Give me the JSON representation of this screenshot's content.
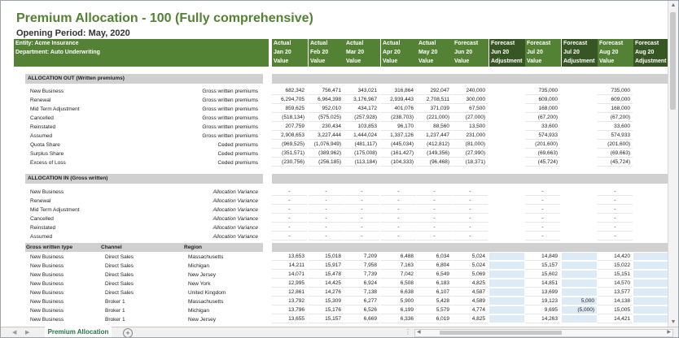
{
  "title": "Premium Allocation - 100 (Fully comprehensive)",
  "subtitle": "Opening Period: May, 2020",
  "header": {
    "entity": "Entity: Acme Insurance",
    "department": "Department: Auto Underwriting",
    "columns": [
      {
        "l1": "Actual",
        "l2": "Jan 20",
        "l3": "Value"
      },
      {
        "l1": "Actual",
        "l2": "Feb 20",
        "l3": "Value"
      },
      {
        "l1": "Actual",
        "l2": "Mar 20",
        "l3": "Value"
      },
      {
        "l1": "Actual",
        "l2": "Apr 20",
        "l3": "Value"
      },
      {
        "l1": "Actual",
        "l2": "May 20",
        "l3": "Value"
      },
      {
        "l1": "Forecast",
        "l2": "Jun 20",
        "l3": "Value"
      },
      {
        "l1": "Forecast",
        "l2": "Jun 20",
        "l3": "Adjustment"
      },
      {
        "l1": "Forecast",
        "l2": "Jul 20",
        "l3": "Value"
      },
      {
        "l1": "Forecast",
        "l2": "Jul 20",
        "l3": "Adjustment"
      },
      {
        "l1": "Forecast",
        "l2": "Aug 20",
        "l3": "Value"
      },
      {
        "l1": "Forecast",
        "l2": "Aug 20",
        "l3": "Adjustment"
      }
    ]
  },
  "sections": {
    "out_title": "ALLOCATION OUT (Written premiums)",
    "in_title": "ALLOCATION IN (Gross written)"
  },
  "alloc_out": [
    {
      "label": "New Business",
      "type": "Gross written premiums",
      "v": [
        "682,342",
        "756,471",
        "343,021",
        "316,864",
        "292,047",
        "240,000",
        "",
        "735,000",
        "",
        "735,000",
        ""
      ]
    },
    {
      "label": "Renewal",
      "type": "Gross written premiums",
      "v": [
        "6,294,705",
        "6,964,398",
        "3,176,967",
        "2,939,443",
        "2,708,511",
        "300,000",
        "",
        "609,000",
        "",
        "609,000",
        ""
      ]
    },
    {
      "label": "Mid Term Adjustment",
      "type": "Gross written premiums",
      "v": [
        "859,625",
        "952,010",
        "434,172",
        "401,076",
        "371,039",
        "67,500",
        "",
        "168,000",
        "",
        "168,000",
        ""
      ]
    },
    {
      "label": "Cancelled",
      "type": "Gross written premiums",
      "v": [
        "(518,134)",
        "(575,025)",
        "(257,928)",
        "(238,703)",
        "(221,000)",
        "(27,000)",
        "",
        "(67,200)",
        "",
        "(67,200)",
        ""
      ]
    },
    {
      "label": "Reinstated",
      "type": "Gross written premiums",
      "v": [
        "207,759",
        "230,434",
        "103,853",
        "96,170",
        "88,560",
        "13,500",
        "",
        "33,600",
        "",
        "33,600",
        ""
      ]
    },
    {
      "label": "Assumed",
      "type": "Gross written premiums",
      "v": [
        "2,908,653",
        "3,227,444",
        "1,444,024",
        "1,337,126",
        "1,237,447",
        "231,000",
        "",
        "574,933",
        "",
        "574,933",
        ""
      ]
    },
    {
      "label": "Quota Share",
      "type": "Ceded premiums",
      "v": [
        "(969,525)",
        "(1,076,949)",
        "(481,117)",
        "(445,034)",
        "(412,812)",
        "(81,000)",
        "",
        "(201,600)",
        "",
        "(201,600)",
        ""
      ]
    },
    {
      "label": "Surplus Share",
      "type": "Ceded premiums",
      "v": [
        "(351,571)",
        "(389,962)",
        "(175,008)",
        "(161,427)",
        "(149,356)",
        "(27,990)",
        "",
        "(69,663)",
        "",
        "(69,663)",
        ""
      ]
    },
    {
      "label": "Excess of Loss",
      "type": "Ceded premiums",
      "v": [
        "(230,756)",
        "(256,185)",
        "(113,184)",
        "(104,333)",
        "(96,468)",
        "(18,371)",
        "",
        "(45,724)",
        "",
        "(45,724)",
        ""
      ]
    }
  ],
  "alloc_in": [
    {
      "label": "New Business",
      "type": "Allocation Variance",
      "v": [
        "-",
        "-",
        "-",
        "-",
        "-",
        "-",
        "",
        "-",
        "",
        "-",
        ""
      ]
    },
    {
      "label": "Renewal",
      "type": "Allocation Variance",
      "v": [
        "-",
        "-",
        "-",
        "-",
        "-",
        "-",
        "",
        "-",
        "",
        "-",
        ""
      ]
    },
    {
      "label": "Mid Term Adjustment",
      "type": "Allocation Variance",
      "v": [
        "-",
        "-",
        "-",
        "-",
        "-",
        "-",
        "",
        "-",
        "",
        "-",
        ""
      ]
    },
    {
      "label": "Cancelled",
      "type": "Allocation Variance",
      "v": [
        "-",
        "-",
        "-",
        "-",
        "-",
        "-",
        "",
        "-",
        "",
        "-",
        ""
      ]
    },
    {
      "label": "Reinstated",
      "type": "Allocation Variance",
      "v": [
        "-",
        "-",
        "-",
        "-",
        "-",
        "-",
        "",
        "-",
        "",
        "-",
        ""
      ]
    },
    {
      "label": "Assumed",
      "type": "Allocation Variance",
      "v": [
        "-",
        "-",
        "-",
        "-",
        "-",
        "-",
        "",
        "-",
        "",
        "-",
        ""
      ]
    }
  ],
  "gw_headers": {
    "type": "Gross written type",
    "channel": "Channel",
    "region": "Region"
  },
  "gw_rows": [
    {
      "label": "New Business",
      "channel": "Direct Sales",
      "region": "Massachusetts",
      "v": [
        "13,653",
        "15,018",
        "7,209",
        "6,488",
        "6,034",
        "5,024",
        "",
        "14,849",
        "",
        "14,420",
        ""
      ]
    },
    {
      "label": "New Business",
      "channel": "Direct Sales",
      "region": "Michigan",
      "v": [
        "14,211",
        "15,917",
        "7,958",
        "7,163",
        "6,804",
        "5,024",
        "",
        "15,157",
        "",
        "15,022",
        ""
      ]
    },
    {
      "label": "New Business",
      "channel": "Direct Sales",
      "region": "New Jersey",
      "v": [
        "14,071",
        "15,478",
        "7,739",
        "7,042",
        "6,549",
        "5,069",
        "",
        "15,602",
        "",
        "15,151",
        ""
      ]
    },
    {
      "label": "New Business",
      "channel": "Direct Sales",
      "region": "New York",
      "v": [
        "12,995",
        "14,425",
        "6,924",
        "6,508",
        "6,183",
        "4,825",
        "",
        "14,851",
        "",
        "14,570",
        ""
      ]
    },
    {
      "label": "New Business",
      "channel": "Direct Sales",
      "region": "United Kingdom",
      "v": [
        "12,861",
        "14,276",
        "7,138",
        "6,638",
        "6,107",
        "4,587",
        "",
        "13,699",
        "",
        "13,577",
        ""
      ]
    },
    {
      "label": "New Business",
      "channel": "Broker 1",
      "region": "Massachusetts",
      "v": [
        "13,792",
        "15,309",
        "6,277",
        "5,900",
        "5,428",
        "4,589",
        "",
        "19,123",
        "5,000",
        "14,138",
        ""
      ]
    },
    {
      "label": "New Business",
      "channel": "Broker 1",
      "region": "Michigan",
      "v": [
        "13,796",
        "15,176",
        "6,526",
        "6,199",
        "5,579",
        "4,774",
        "",
        "9,695",
        "(5,000)",
        "15,005",
        ""
      ]
    },
    {
      "label": "New Business",
      "channel": "Broker 1",
      "region": "New Jersey",
      "v": [
        "13,655",
        "15,157",
        "6,669",
        "6,336",
        "6,019",
        "4,825",
        "",
        "14,263",
        "",
        "14,421",
        ""
      ]
    }
  ],
  "tabs": {
    "active": "Premium Allocation"
  }
}
